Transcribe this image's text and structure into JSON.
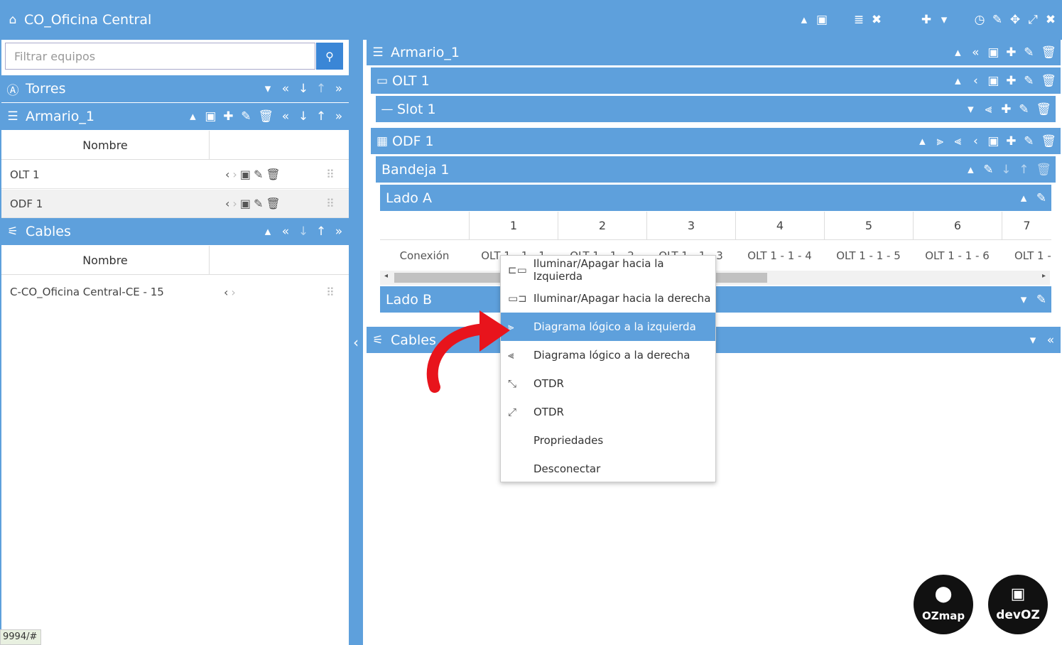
{
  "header": {
    "title": "CO_Oficina Central"
  },
  "left": {
    "search_placeholder": "Filtrar equipos",
    "torres": {
      "title": "Torres"
    },
    "armario": {
      "title": "Armario_1",
      "column": "Nombre",
      "rows": [
        {
          "name": "OLT 1"
        },
        {
          "name": "ODF 1"
        }
      ]
    },
    "cables": {
      "title": "Cables",
      "column": "Nombre",
      "rows": [
        {
          "name": "C-CO_Oficina Central-CE - 15"
        }
      ]
    }
  },
  "right": {
    "armario": "Armario_1",
    "olt": "OLT 1",
    "slot": "Slot 1",
    "odf": "ODF 1",
    "bandeja": "Bandeja 1",
    "lado_a": "Lado A",
    "lado_b": "Lado B",
    "cables": "Cables",
    "ports": [
      "1",
      "2",
      "3",
      "4",
      "5",
      "6",
      "7"
    ],
    "conn_label": "Conexión",
    "connections": [
      "OLT 1 - 1 - 1",
      "OLT 1 - 1 - 2",
      "OLT 1 - 1 - 3",
      "OLT 1 - 1 - 4",
      "OLT 1 - 1 - 5",
      "OLT 1 - 1 - 6",
      "OLT 1 -"
    ]
  },
  "context_menu": [
    {
      "label": "Iluminar/Apagar hacia la Izquierda",
      "icon": "flashlight-left-icon"
    },
    {
      "label": "Iluminar/Apagar hacia la derecha",
      "icon": "flashlight-right-icon"
    },
    {
      "label": "Diagrama lógico a la izquierda",
      "icon": "diagram-left-icon",
      "selected": true
    },
    {
      "label": "Diagrama lógico a la derecha",
      "icon": "diagram-right-icon"
    },
    {
      "label": "OTDR",
      "icon": "otdr-icon"
    },
    {
      "label": "OTDR",
      "icon": "otdr-reverse-icon"
    },
    {
      "label": "Propriedades",
      "icon": ""
    },
    {
      "label": "Desconectar",
      "icon": ""
    }
  ],
  "logos": {
    "ozmap": "OZmap",
    "devoz": "devOZ"
  },
  "status_url": "9994/#",
  "colors": {
    "accent": "#5ea0dc",
    "search_button": "#3a86d6",
    "arrow": "#e8141c"
  }
}
